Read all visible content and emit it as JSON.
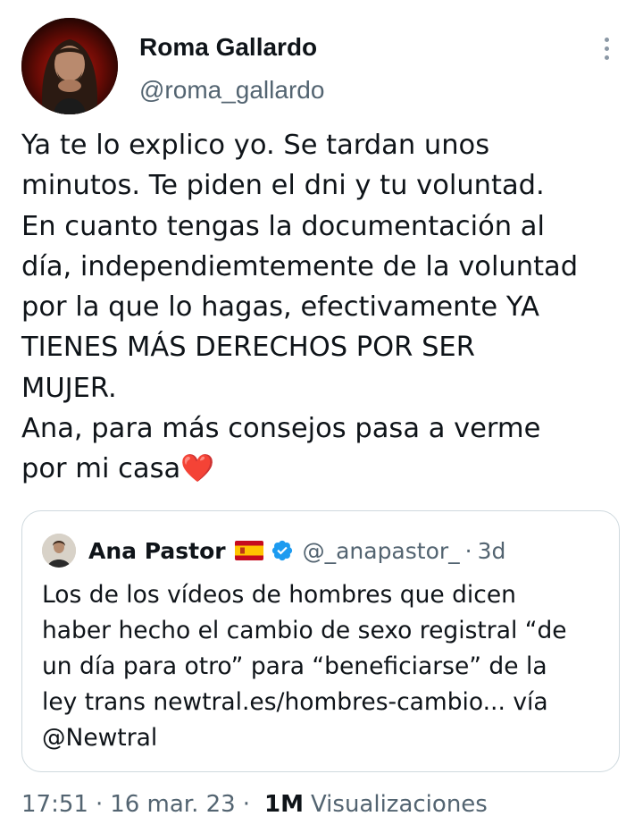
{
  "author": {
    "display_name": "Roma Gallardo",
    "handle": "@roma_gallardo"
  },
  "tweet": {
    "lines": [
      "Ya te lo explico yo. Se tardan unos",
      "minutos. Te piden el dni y tu voluntad.",
      "En cuanto tengas la documentación al",
      "día, independiemtemente de la voluntad",
      "por la que lo hagas, efectivamente YA",
      "TIENES MÁS DERECHOS POR SER",
      "MUJER.",
      "Ana, para más consejos pasa a verme",
      "por mi casa"
    ],
    "heart_emoji": "❤️"
  },
  "quoted_tweet": {
    "display_name": "Ana Pastor",
    "handle": "@_anapastor_",
    "separator": "·",
    "time": "3d",
    "lines": [
      "Los de los vídeos de hombres que dicen",
      "haber hecho el cambio de sexo registral “de",
      "un día para otro” para “beneficiarse” de la",
      "ley trans newtral.es/hombres-cambio... vía",
      "@Newtral"
    ]
  },
  "meta": {
    "time": "17:51",
    "dot1": "·",
    "date": "16 mar. 23",
    "dot2": "·",
    "views_count": "1M",
    "views_label": "Visualizaciones"
  },
  "icons": {
    "more": "more-vertical-icon",
    "verified": "verified-badge-icon",
    "flag": "spain-flag-icon"
  },
  "colors": {
    "text_primary": "#0f1419",
    "text_secondary": "#536471",
    "border": "#cfd9de",
    "verified_blue": "#1d9bf0",
    "heart": "#e0245e"
  }
}
